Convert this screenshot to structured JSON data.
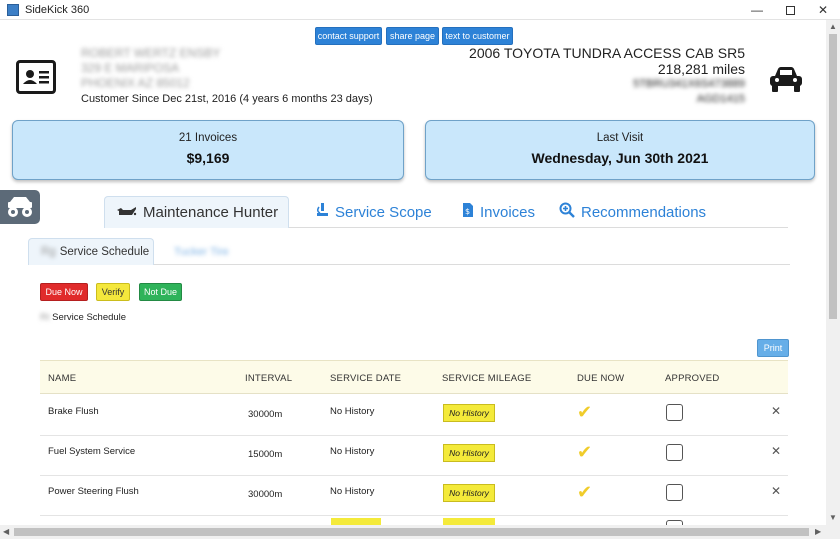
{
  "window": {
    "title": "SideKick 360"
  },
  "header_buttons": {
    "contact_support": "contact support",
    "share_page": "share page",
    "text_to_customer": "text to customer"
  },
  "customer": {
    "name": "ROBERT WERTZ ENSBY",
    "address1": "329 E MARIPOSA",
    "address2": "PHOENIX AZ 85012",
    "since": "Customer Since Dec 21st, 2016 (4 years 6 months 23 days)"
  },
  "vehicle": {
    "title": "2006 TOYOTA TUNDRA ACCESS CAB SR5",
    "mileage": "218,281 miles",
    "vin": "5TBRU341X6S473889",
    "tag": "AGD1415"
  },
  "summary": {
    "invoices_label": "21 Invoices",
    "invoices_total": "$9,169",
    "last_visit_label": "Last Visit",
    "last_visit_date": "Wednesday, Jun 30th 2021"
  },
  "main_tabs": [
    {
      "label": "Maintenance Hunter",
      "icon": "oil-can-icon"
    },
    {
      "label": "Service Scope",
      "icon": "scope-icon"
    },
    {
      "label": "Invoices",
      "icon": "invoice-icon"
    },
    {
      "label": "Recommendations",
      "icon": "search-plus-icon"
    }
  ],
  "sub_tabs": {
    "active_prefix": "Rg",
    "active": "Service Schedule",
    "second": "Tucker Tire"
  },
  "legend": {
    "due_now": "Due Now",
    "verify": "Verify",
    "not_due": "Not Due"
  },
  "schedule": {
    "prefix": "Rt",
    "label": "Service Schedule"
  },
  "print_label": "Print",
  "table": {
    "headers": {
      "name": "NAME",
      "interval": "INTERVAL",
      "service_date": "SERVICE DATE",
      "service_mileage": "SERVICE MILEAGE",
      "due_now": "DUE NOW",
      "approved": "APPROVED"
    },
    "rows": [
      {
        "name": "Brake Flush",
        "interval": "30000m",
        "service_date": "No History",
        "service_mileage": "No History"
      },
      {
        "name": "Fuel System Service",
        "interval": "15000m",
        "service_date": "No History",
        "service_mileage": "No History"
      },
      {
        "name": "Power Steering Flush",
        "interval": "30000m",
        "service_date": "No History",
        "service_mileage": "No History"
      }
    ]
  },
  "colors": {
    "accent": "#2d82d7",
    "summary_bg": "#c9e7fb",
    "due_now": "#e02b2b",
    "verify": "#f4e73c",
    "not_due": "#2fb35a",
    "check": "#f0cc2a"
  }
}
